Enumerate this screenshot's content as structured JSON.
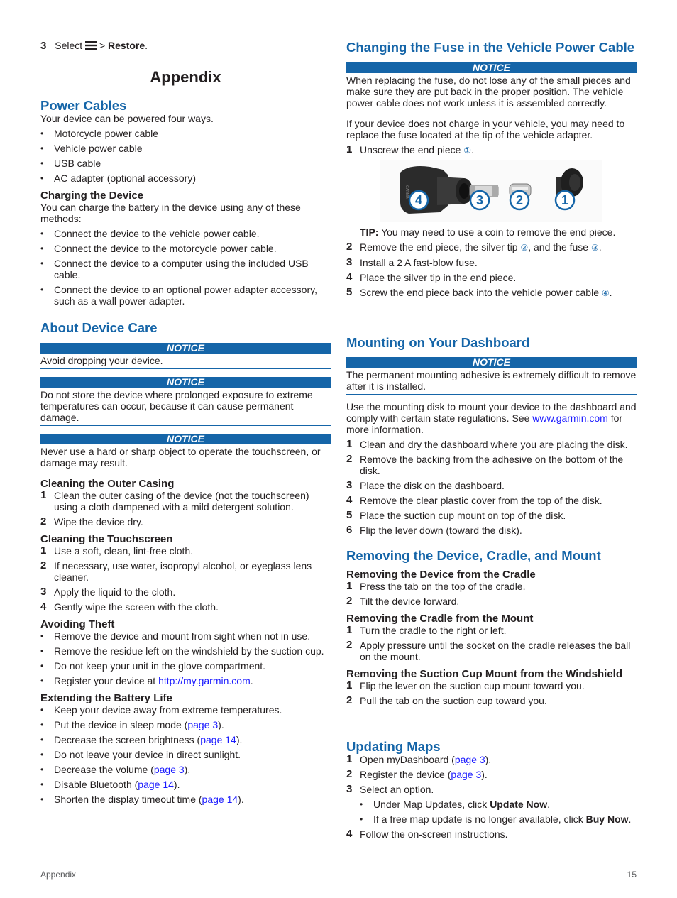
{
  "top_step": {
    "num": "3",
    "prefix": "Select",
    "icon": "menu-icon",
    "sep": ">",
    "target": "Restore",
    "suffix": "."
  },
  "title": "Appendix",
  "power_cables": {
    "heading": "Power Cables",
    "intro": "Your device can be powered four ways.",
    "items": [
      "Motorcycle power cable",
      "Vehicle power cable",
      "USB cable",
      "AC adapter (optional accessory)"
    ],
    "charging": {
      "heading": "Charging the Device",
      "intro": "You can charge the battery in the device using any of these methods:",
      "items": [
        "Connect the device to the vehicle power cable.",
        "Connect the device to the motorcycle power cable.",
        "Connect the device to a computer using the included USB cable.",
        "Connect the device to an optional power adapter accessory, such as a wall power adapter."
      ]
    }
  },
  "device_care": {
    "heading": "About Device Care",
    "notices": [
      {
        "label": "NOTICE",
        "text": "Avoid dropping your device."
      },
      {
        "label": "NOTICE",
        "text": "Do not store the device where prolonged exposure to extreme temperatures can occur, because it can cause permanent damage."
      },
      {
        "label": "NOTICE",
        "text": "Never use a hard or sharp object to operate the touchscreen, or damage may result."
      }
    ],
    "outer_casing": {
      "heading": "Cleaning the Outer Casing",
      "steps": [
        {
          "num": "1",
          "text": "Clean the outer casing of the device (not the touchscreen) using a cloth dampened with a mild detergent solution."
        },
        {
          "num": "2",
          "text": "Wipe the device dry."
        }
      ]
    },
    "touchscreen": {
      "heading": "Cleaning the Touchscreen",
      "steps": [
        {
          "num": "1",
          "text": "Use a soft, clean, lint-free cloth."
        },
        {
          "num": "2",
          "text": "If necessary, use water, isopropyl alcohol, or eyeglass lens cleaner."
        },
        {
          "num": "3",
          "text": "Apply the liquid to the cloth."
        },
        {
          "num": "4",
          "text": "Gently wipe the screen with the cloth."
        }
      ]
    },
    "theft": {
      "heading": "Avoiding Theft",
      "items": [
        "Remove the device and mount from sight when not in use.",
        "Remove the residue left on the windshield by the suction cup.",
        "Do not keep your unit in the glove compartment."
      ],
      "register_prefix": "Register your device at ",
      "register_link": "http://my.garmin.com",
      "register_suffix": "."
    },
    "battery": {
      "heading": "Extending the Battery Life",
      "items": [
        {
          "text": "Keep your device away from extreme temperatures.",
          "link": null
        },
        {
          "text": "Put the device in sleep mode (",
          "link": "page 3",
          "after": ")."
        },
        {
          "text": "Decrease the screen brightness (",
          "link": "page 14",
          "after": ")."
        },
        {
          "text": "Do not leave your device in direct sunlight.",
          "link": null
        },
        {
          "text": "Decrease the volume (",
          "link": "page 3",
          "after": ")."
        },
        {
          "text": "Disable Bluetooth (",
          "link": "page 14",
          "after": ")."
        },
        {
          "text": "Shorten the display timeout time (",
          "link": "page 14",
          "after": ")."
        }
      ]
    }
  },
  "fuse": {
    "heading": "Changing the Fuse in the Vehicle Power Cable",
    "notice": {
      "label": "NOTICE",
      "text": "When replacing the fuse, do not lose any of the small pieces and make sure they are put back in the proper position. The vehicle power cable does not work unless it is assembled correctly."
    },
    "intro": "If your device does not charge in your vehicle, you may need to replace the fuse located at the tip of the vehicle adapter.",
    "step1": {
      "num": "1",
      "text": "Unscrew the end piece ",
      "callout": "①",
      "after": "."
    },
    "figure_labels": [
      "4",
      "3",
      "2",
      "1"
    ],
    "figure_brand": "GARMIN",
    "tip_label": "TIP:",
    "tip_text": " You may need to use a coin to remove the end piece.",
    "step2": {
      "num": "2",
      "a": "Remove the end piece, the silver tip ",
      "c1": "②",
      "b": ", and the fuse ",
      "c2": "③",
      "after": "."
    },
    "step3": {
      "num": "3",
      "text": "Install a 2 A fast-blow fuse."
    },
    "step4": {
      "num": "4",
      "text": "Place the silver tip in the end piece."
    },
    "step5": {
      "num": "5",
      "text": "Screw the end piece back into the vehicle power cable ",
      "callout": "④",
      "after": "."
    }
  },
  "dashboard": {
    "heading": "Mounting on Your Dashboard",
    "notice": {
      "label": "NOTICE",
      "text": "The permanent mounting adhesive is extremely difficult to remove after it is installed."
    },
    "intro_a": "Use the mounting disk to mount your device to the dashboard and comply with certain state regulations. See ",
    "intro_link": "www.garmin.com",
    "intro_b": " for more information.",
    "steps": [
      {
        "num": "1",
        "text": "Clean and dry the dashboard where you are placing the disk."
      },
      {
        "num": "2",
        "text": "Remove the backing from the adhesive on the bottom of the disk."
      },
      {
        "num": "3",
        "text": "Place the disk on the dashboard."
      },
      {
        "num": "4",
        "text": "Remove the clear plastic cover from the top of the disk."
      },
      {
        "num": "5",
        "text": "Place the suction cup mount on top of the disk."
      },
      {
        "num": "6",
        "text": "Flip the lever down (toward the disk)."
      }
    ]
  },
  "removing": {
    "heading": "Removing the Device, Cradle, and Mount",
    "from_cradle": {
      "heading": "Removing the Device from the Cradle",
      "steps": [
        {
          "num": "1",
          "text": "Press the tab on the top of the cradle."
        },
        {
          "num": "2",
          "text": "Tilt the device forward."
        }
      ]
    },
    "from_mount": {
      "heading": "Removing the Cradle from the Mount",
      "steps": [
        {
          "num": "1",
          "text": "Turn the cradle to the right or left."
        },
        {
          "num": "2",
          "text": "Apply pressure until the socket on the cradle releases the ball on the mount."
        }
      ]
    },
    "suction": {
      "heading": "Removing the Suction Cup Mount from the Windshield",
      "steps": [
        {
          "num": "1",
          "text": "Flip the lever on the suction cup mount toward you."
        },
        {
          "num": "2",
          "text": "Pull the tab on the suction cup toward you."
        }
      ]
    }
  },
  "maps": {
    "heading": "Updating Maps",
    "step1": {
      "num": "1",
      "text": "Open myDashboard (",
      "link": "page 3",
      "after": ")."
    },
    "step2": {
      "num": "2",
      "text": "Register the device (",
      "link": "page 3",
      "after": ")."
    },
    "step3": {
      "num": "3",
      "text": "Select an option."
    },
    "options": [
      {
        "a": "Under Map Updates, click ",
        "bold": "Update Now",
        "after": "."
      },
      {
        "a": "If a free map update is no longer available, click ",
        "bold": "Buy Now",
        "after": "."
      }
    ],
    "step4": {
      "num": "4",
      "text": "Follow the on-screen instructions."
    }
  },
  "footer": {
    "section": "Appendix",
    "page": "15"
  }
}
